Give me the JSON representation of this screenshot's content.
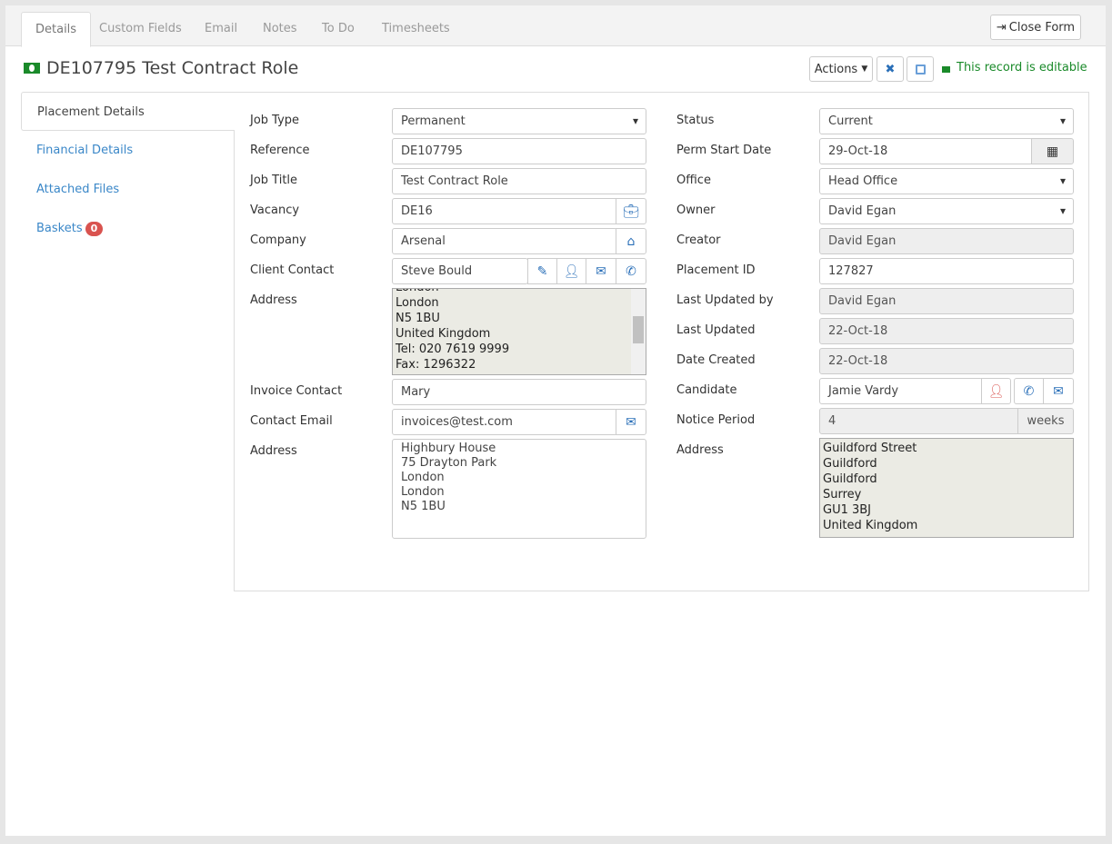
{
  "tabs": [
    "Details",
    "Custom Fields",
    "Email",
    "Notes",
    "To Do",
    "Timesheets"
  ],
  "close_form": "Close Form",
  "title": "DE107795 Test Contract Role",
  "actions": "Actions",
  "editable": "This record is editable",
  "nav": {
    "items": [
      "Placement Details",
      "Financial Details",
      "Attached Files",
      "Baskets"
    ],
    "baskets_count": "0"
  },
  "left": {
    "job_type": {
      "label": "Job Type",
      "value": "Permanent"
    },
    "reference": {
      "label": "Reference",
      "value": "DE107795"
    },
    "job_title": {
      "label": "Job Title",
      "value": "Test Contract Role"
    },
    "vacancy": {
      "label": "Vacancy",
      "value": "DE16"
    },
    "company": {
      "label": "Company",
      "value": "Arsenal"
    },
    "client_contact": {
      "label": "Client Contact",
      "value": "Steve Bould"
    },
    "address": {
      "label": "Address",
      "lines": [
        "London",
        "London",
        "N5 1BU",
        "United Kingdom",
        "Tel: 020 7619 9999",
        "Fax: 1296322"
      ]
    },
    "invoice_contact": {
      "label": "Invoice Contact",
      "value": "Mary"
    },
    "contact_email": {
      "label": "Contact Email",
      "value": "invoices@test.com"
    },
    "invoice_address": {
      "label": "Address",
      "lines": [
        "Highbury House",
        "75 Drayton Park",
        "London",
        "London",
        "N5 1BU"
      ]
    }
  },
  "right": {
    "status": {
      "label": "Status",
      "value": "Current"
    },
    "perm_start": {
      "label": "Perm Start Date",
      "value": "29-Oct-18"
    },
    "office": {
      "label": "Office",
      "value": "Head Office"
    },
    "owner": {
      "label": "Owner",
      "value": "David Egan"
    },
    "creator": {
      "label": "Creator",
      "value": "David Egan"
    },
    "placement_id": {
      "label": "Placement ID",
      "value": "127827"
    },
    "last_updated_by": {
      "label": "Last Updated by",
      "value": "David Egan"
    },
    "last_updated": {
      "label": "Last Updated",
      "value": "22-Oct-18"
    },
    "date_created": {
      "label": "Date Created",
      "value": "22-Oct-18"
    },
    "candidate": {
      "label": "Candidate",
      "value": "Jamie Vardy"
    },
    "notice": {
      "label": "Notice Period",
      "value": "4",
      "unit": "weeks"
    },
    "address": {
      "label": "Address",
      "lines": [
        "Guildford Street",
        "Guildford",
        "Guildford",
        "Surrey",
        "GU1 3BJ",
        "United Kingdom"
      ]
    }
  }
}
